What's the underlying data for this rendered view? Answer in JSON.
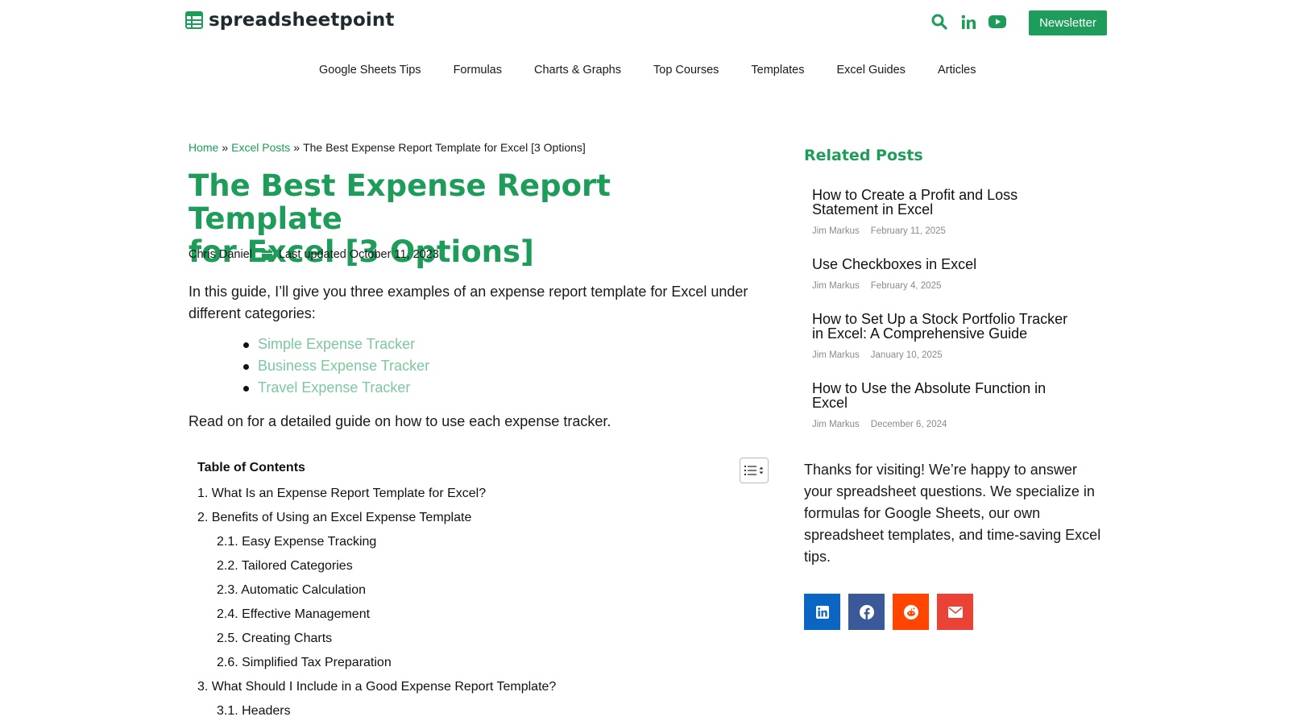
{
  "brand": {
    "name": "spreadsheetpoint",
    "accent": "#1e9c5a",
    "light_link": "#7cc8a0"
  },
  "header": {
    "icons": [
      "search-icon",
      "linkedin-icon",
      "youtube-icon"
    ],
    "newsletter_label": "Newsletter"
  },
  "nav": {
    "items": [
      "Google Sheets Tips",
      "Formulas",
      "Charts & Graphs",
      "Top Courses",
      "Templates",
      "Excel Guides",
      "Articles"
    ]
  },
  "breadcrumb": {
    "home": "Home",
    "sep1": "»",
    "section": "Excel Posts",
    "sep2": "»",
    "current": "The Best Expense Report Template for Excel [3 Options]"
  },
  "article": {
    "title_line1": "The Best Expense Report Template",
    "title_line2": "for Excel [3 Options]",
    "author": "Chris Daniel",
    "updated": "Last updated October 11, 2023",
    "intro": "In this guide, I’ll give you three examples of an expense report template for Excel under different categories:",
    "links": [
      "Simple Expense Tracker",
      "Business Expense Tracker",
      "Travel Expense Tracker"
    ],
    "read_on": "Read on for a detailed guide on how to use each expense tracker."
  },
  "toc": {
    "title": "Table of Contents",
    "items": [
      {
        "text": "1. What Is an Expense Report Template for Excel?",
        "level": 1
      },
      {
        "text": "2. Benefits of Using an Excel Expense Template",
        "level": 1
      },
      {
        "text": "2.1. Easy Expense Tracking",
        "level": 2
      },
      {
        "text": "2.2. Tailored Categories",
        "level": 2
      },
      {
        "text": "2.3. Automatic Calculation",
        "level": 2
      },
      {
        "text": "2.4. Effective Management",
        "level": 2
      },
      {
        "text": "2.5. Creating Charts",
        "level": 2
      },
      {
        "text": "2.6. Simplified Tax Preparation",
        "level": 2
      },
      {
        "text": "3. What Should I Include in a Good Expense Report Template?",
        "level": 1
      },
      {
        "text": "3.1. Headers",
        "level": 2
      }
    ]
  },
  "sidebar": {
    "related_title": "Related Posts",
    "posts": [
      {
        "title_1": "How to Create a Profit and Loss",
        "title_2": "Statement in Excel",
        "author": "Jim Markus",
        "date": "February 11, 2025"
      },
      {
        "title_1": "Use Checkboxes in Excel",
        "title_2": "",
        "author": "Jim Markus",
        "date": "February 4, 2025"
      },
      {
        "title_1": "How to Set Up a Stock Portfolio Tracker",
        "title_2": "in Excel: A Comprehensive Guide",
        "author": "Jim Markus",
        "date": "January 10, 2025"
      },
      {
        "title_1": "How to Use the Absolute Function in",
        "title_2": "Excel",
        "author": "Jim Markus",
        "date": "December 6, 2024"
      }
    ],
    "thanks": "Thanks for visiting! We’re happy to answer your spreadsheet questions. We specialize in formulas for Google Sheets, our own spreadsheet templates, and time-saving Excel tips.",
    "share": [
      {
        "icon": "linkedin-icon",
        "color": "#0a66c2"
      },
      {
        "icon": "facebook-icon",
        "color": "#3b5998"
      },
      {
        "icon": "reddit-icon",
        "color": "#ff4500"
      },
      {
        "icon": "email-icon",
        "color": "#ea4335"
      }
    ]
  }
}
